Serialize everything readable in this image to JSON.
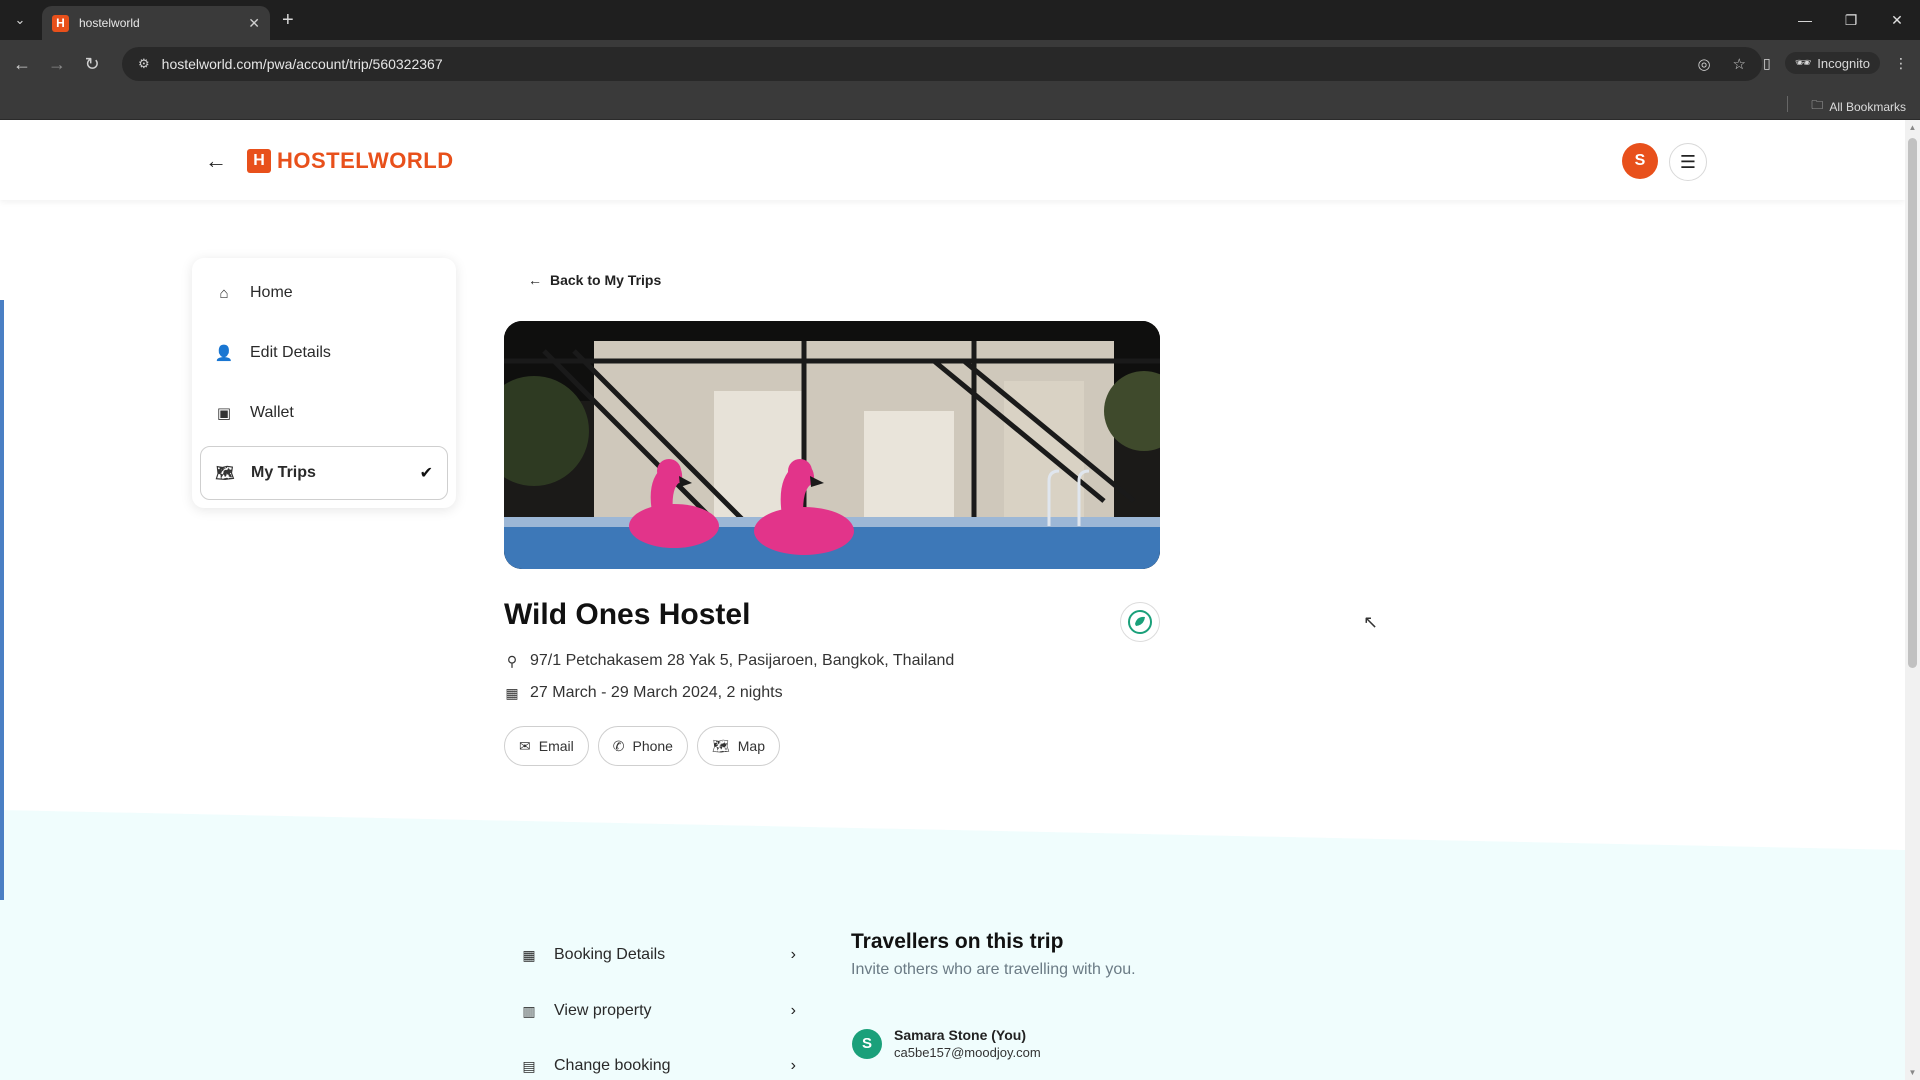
{
  "browser": {
    "tab_title": "hostelworld",
    "tab_favicon_letter": "H",
    "url": "hostelworld.com/pwa/account/trip/560322367",
    "incognito_label": "Incognito",
    "all_bookmarks_label": "All Bookmarks"
  },
  "header": {
    "logo_letter": "H",
    "logo_text": "HOSTELWORLD",
    "avatar_letter": "S",
    "brand_color": "#e8501b"
  },
  "sidebar": {
    "items": [
      {
        "label": "Home",
        "icon": "home-icon"
      },
      {
        "label": "Edit Details",
        "icon": "user-icon"
      },
      {
        "label": "Wallet",
        "icon": "wallet-icon"
      },
      {
        "label": "My Trips",
        "icon": "map-icon",
        "active": true
      }
    ]
  },
  "trip": {
    "back_label": "Back to My Trips",
    "hostel_name": "Wild Ones Hostel",
    "address": "97/1 Petchakasem 28 Yak 5, Pasijaroen, Bangkok, Thailand",
    "dates": "27 March - 29 March 2024, 2 nights",
    "contacts": [
      {
        "label": "Email",
        "icon": "mail-icon"
      },
      {
        "label": "Phone",
        "icon": "phone-icon"
      },
      {
        "label": "Map",
        "icon": "map-icon"
      }
    ]
  },
  "booking": {
    "links": [
      {
        "label": "Booking Details",
        "icon": "calendar-icon"
      },
      {
        "label": "View property",
        "icon": "building-icon"
      },
      {
        "label": "Change booking",
        "icon": "calendar-edit-icon"
      }
    ]
  },
  "travellers": {
    "title": "Travellers on this trip",
    "subtitle": "Invite others who are travelling with you.",
    "list": [
      {
        "initial": "S",
        "name": "Samara Stone (You)",
        "email": "ca5be157@moodjoy.com"
      }
    ]
  }
}
